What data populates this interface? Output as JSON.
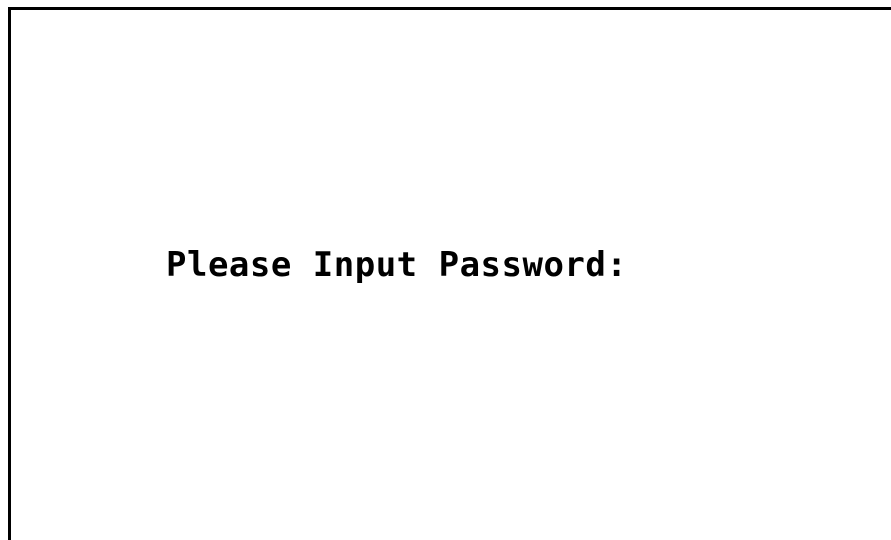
{
  "screen": {
    "prompt_text": "Please Input Password:",
    "background_color": "#ffffff",
    "text_color": "#000000",
    "frame_color": "#000000"
  }
}
